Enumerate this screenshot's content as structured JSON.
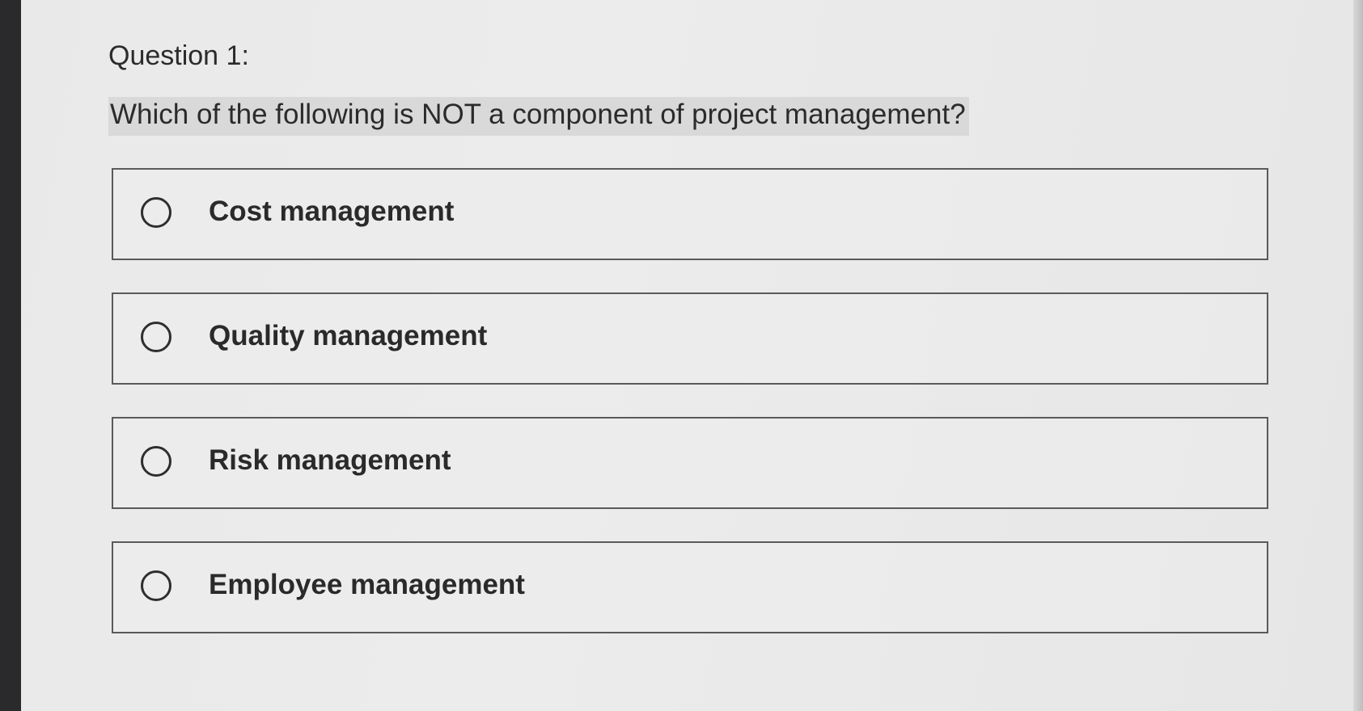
{
  "question": {
    "number_label": "Question 1:",
    "text": "Which of the following is NOT a component of project management?"
  },
  "options": [
    {
      "label": "Cost management"
    },
    {
      "label": "Quality management"
    },
    {
      "label": "Risk management"
    },
    {
      "label": "Employee management"
    }
  ]
}
